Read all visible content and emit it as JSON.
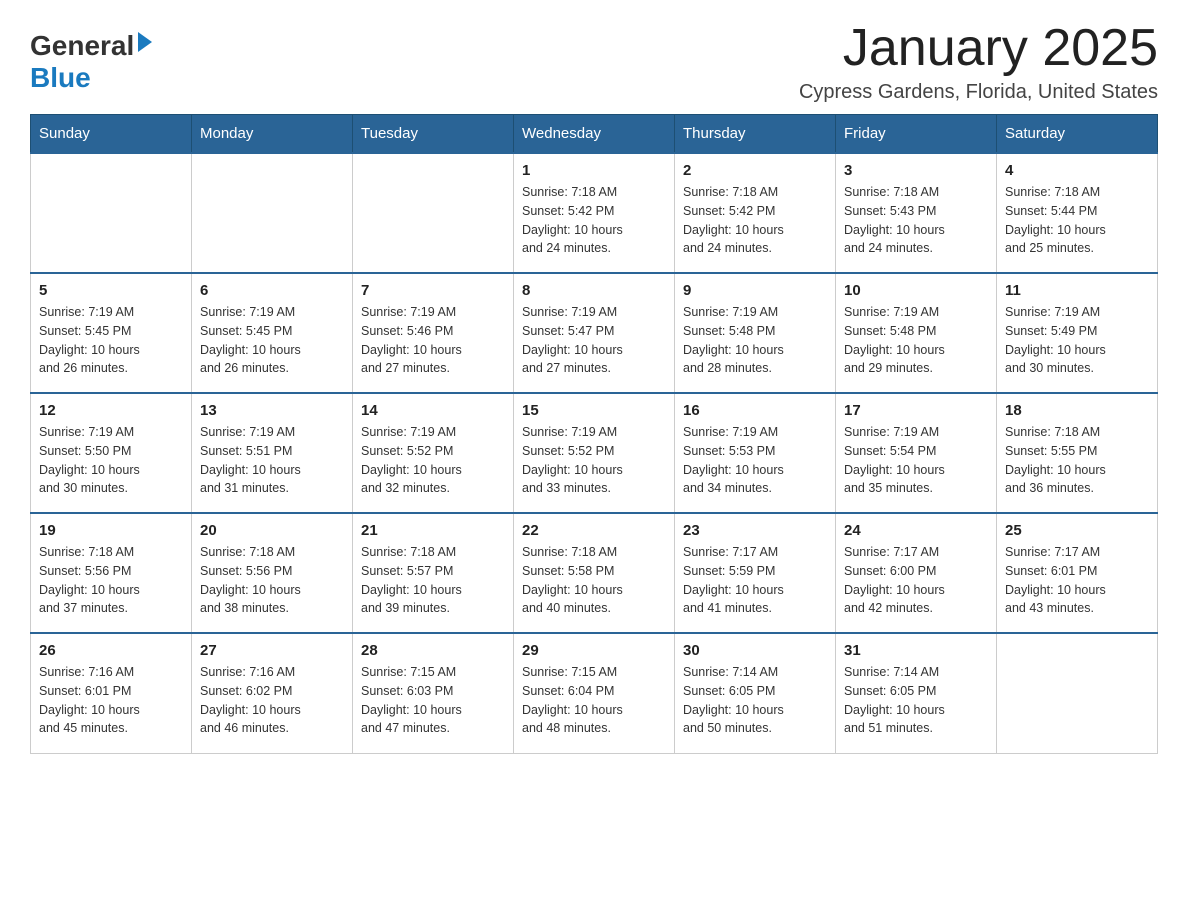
{
  "header": {
    "logo_general": "General",
    "logo_blue": "Blue",
    "month_title": "January 2025",
    "location": "Cypress Gardens, Florida, United States"
  },
  "weekdays": [
    "Sunday",
    "Monday",
    "Tuesday",
    "Wednesday",
    "Thursday",
    "Friday",
    "Saturday"
  ],
  "weeks": [
    [
      {
        "day": "",
        "info": ""
      },
      {
        "day": "",
        "info": ""
      },
      {
        "day": "",
        "info": ""
      },
      {
        "day": "1",
        "info": "Sunrise: 7:18 AM\nSunset: 5:42 PM\nDaylight: 10 hours\nand 24 minutes."
      },
      {
        "day": "2",
        "info": "Sunrise: 7:18 AM\nSunset: 5:42 PM\nDaylight: 10 hours\nand 24 minutes."
      },
      {
        "day": "3",
        "info": "Sunrise: 7:18 AM\nSunset: 5:43 PM\nDaylight: 10 hours\nand 24 minutes."
      },
      {
        "day": "4",
        "info": "Sunrise: 7:18 AM\nSunset: 5:44 PM\nDaylight: 10 hours\nand 25 minutes."
      }
    ],
    [
      {
        "day": "5",
        "info": "Sunrise: 7:19 AM\nSunset: 5:45 PM\nDaylight: 10 hours\nand 26 minutes."
      },
      {
        "day": "6",
        "info": "Sunrise: 7:19 AM\nSunset: 5:45 PM\nDaylight: 10 hours\nand 26 minutes."
      },
      {
        "day": "7",
        "info": "Sunrise: 7:19 AM\nSunset: 5:46 PM\nDaylight: 10 hours\nand 27 minutes."
      },
      {
        "day": "8",
        "info": "Sunrise: 7:19 AM\nSunset: 5:47 PM\nDaylight: 10 hours\nand 27 minutes."
      },
      {
        "day": "9",
        "info": "Sunrise: 7:19 AM\nSunset: 5:48 PM\nDaylight: 10 hours\nand 28 minutes."
      },
      {
        "day": "10",
        "info": "Sunrise: 7:19 AM\nSunset: 5:48 PM\nDaylight: 10 hours\nand 29 minutes."
      },
      {
        "day": "11",
        "info": "Sunrise: 7:19 AM\nSunset: 5:49 PM\nDaylight: 10 hours\nand 30 minutes."
      }
    ],
    [
      {
        "day": "12",
        "info": "Sunrise: 7:19 AM\nSunset: 5:50 PM\nDaylight: 10 hours\nand 30 minutes."
      },
      {
        "day": "13",
        "info": "Sunrise: 7:19 AM\nSunset: 5:51 PM\nDaylight: 10 hours\nand 31 minutes."
      },
      {
        "day": "14",
        "info": "Sunrise: 7:19 AM\nSunset: 5:52 PM\nDaylight: 10 hours\nand 32 minutes."
      },
      {
        "day": "15",
        "info": "Sunrise: 7:19 AM\nSunset: 5:52 PM\nDaylight: 10 hours\nand 33 minutes."
      },
      {
        "day": "16",
        "info": "Sunrise: 7:19 AM\nSunset: 5:53 PM\nDaylight: 10 hours\nand 34 minutes."
      },
      {
        "day": "17",
        "info": "Sunrise: 7:19 AM\nSunset: 5:54 PM\nDaylight: 10 hours\nand 35 minutes."
      },
      {
        "day": "18",
        "info": "Sunrise: 7:18 AM\nSunset: 5:55 PM\nDaylight: 10 hours\nand 36 minutes."
      }
    ],
    [
      {
        "day": "19",
        "info": "Sunrise: 7:18 AM\nSunset: 5:56 PM\nDaylight: 10 hours\nand 37 minutes."
      },
      {
        "day": "20",
        "info": "Sunrise: 7:18 AM\nSunset: 5:56 PM\nDaylight: 10 hours\nand 38 minutes."
      },
      {
        "day": "21",
        "info": "Sunrise: 7:18 AM\nSunset: 5:57 PM\nDaylight: 10 hours\nand 39 minutes."
      },
      {
        "day": "22",
        "info": "Sunrise: 7:18 AM\nSunset: 5:58 PM\nDaylight: 10 hours\nand 40 minutes."
      },
      {
        "day": "23",
        "info": "Sunrise: 7:17 AM\nSunset: 5:59 PM\nDaylight: 10 hours\nand 41 minutes."
      },
      {
        "day": "24",
        "info": "Sunrise: 7:17 AM\nSunset: 6:00 PM\nDaylight: 10 hours\nand 42 minutes."
      },
      {
        "day": "25",
        "info": "Sunrise: 7:17 AM\nSunset: 6:01 PM\nDaylight: 10 hours\nand 43 minutes."
      }
    ],
    [
      {
        "day": "26",
        "info": "Sunrise: 7:16 AM\nSunset: 6:01 PM\nDaylight: 10 hours\nand 45 minutes."
      },
      {
        "day": "27",
        "info": "Sunrise: 7:16 AM\nSunset: 6:02 PM\nDaylight: 10 hours\nand 46 minutes."
      },
      {
        "day": "28",
        "info": "Sunrise: 7:15 AM\nSunset: 6:03 PM\nDaylight: 10 hours\nand 47 minutes."
      },
      {
        "day": "29",
        "info": "Sunrise: 7:15 AM\nSunset: 6:04 PM\nDaylight: 10 hours\nand 48 minutes."
      },
      {
        "day": "30",
        "info": "Sunrise: 7:14 AM\nSunset: 6:05 PM\nDaylight: 10 hours\nand 50 minutes."
      },
      {
        "day": "31",
        "info": "Sunrise: 7:14 AM\nSunset: 6:05 PM\nDaylight: 10 hours\nand 51 minutes."
      },
      {
        "day": "",
        "info": ""
      }
    ]
  ]
}
